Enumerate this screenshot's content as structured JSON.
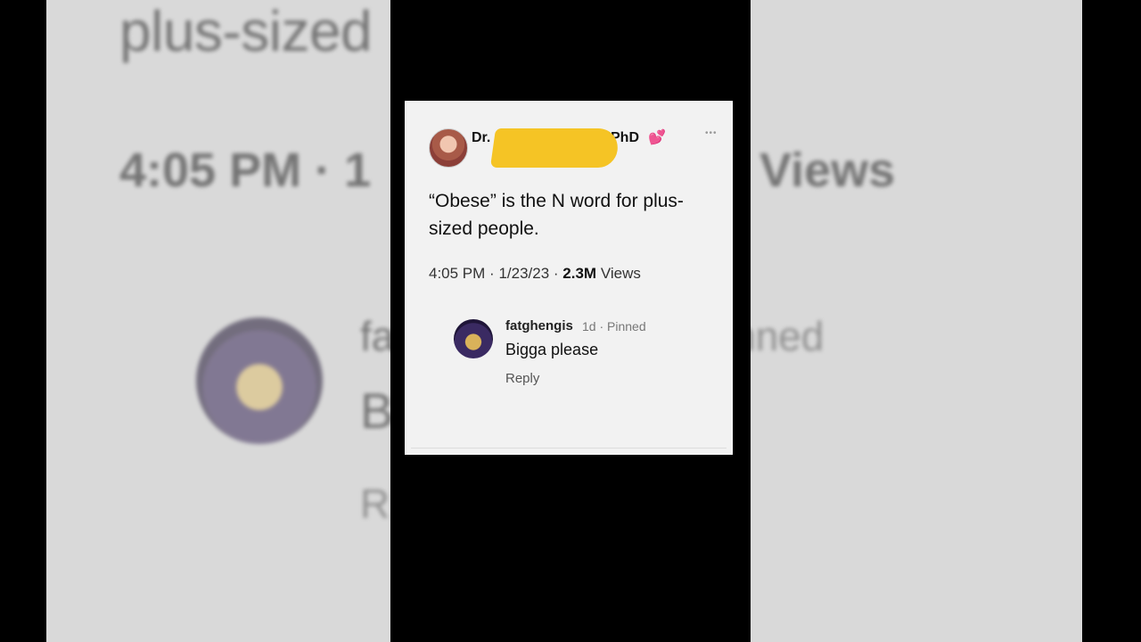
{
  "tweet": {
    "author_prefix": "Dr.",
    "author_suffix": "PhD",
    "text": "“Obese” is the N word for plus-sized people.",
    "time": "4:05 PM",
    "date": "1/23/23",
    "views_count": "2.3M",
    "views_label": "Views"
  },
  "comment": {
    "username": "fatghengis",
    "age": "1d",
    "pinned_label": "Pinned",
    "body": "Bigga please",
    "reply_label": "Reply"
  },
  "background": {
    "top_text": "plus-sized",
    "meta_text": "4:05 PM · 1",
    "views_text": "Views",
    "name_fragment": "fa",
    "pinned_fragment": "nned",
    "body_fragment": "B",
    "reply_fragment": "R"
  },
  "colors": {
    "redaction": "#f5c425",
    "heart": "#e04a86"
  },
  "icons": [
    "heart-icon",
    "more-icon"
  ]
}
